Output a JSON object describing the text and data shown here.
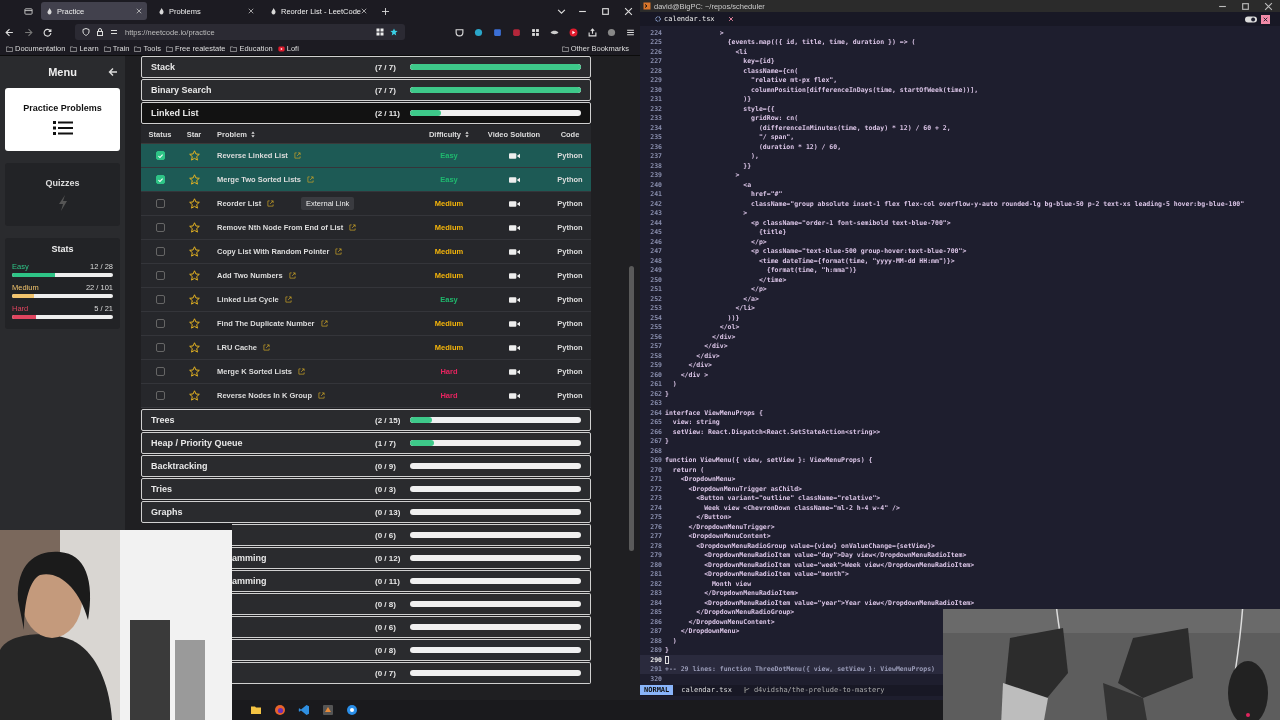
{
  "browser": {
    "tabs": [
      {
        "label": "Practice",
        "selected": true
      },
      {
        "label": "Problems",
        "selected": false
      },
      {
        "label": "Reorder List - LeetCode",
        "selected": false
      }
    ],
    "url": "https://neetcode.io/practice",
    "bookmarks": [
      {
        "label": "Documentation",
        "kind": "folder"
      },
      {
        "label": "Learn",
        "kind": "folder"
      },
      {
        "label": "Train",
        "kind": "folder"
      },
      {
        "label": "Tools",
        "kind": "folder"
      },
      {
        "label": "Free realestate",
        "kind": "folder"
      },
      {
        "label": "Education",
        "kind": "folder"
      },
      {
        "label": "Lofi",
        "kind": "video"
      }
    ],
    "other_bookmarks": "Other Bookmarks"
  },
  "sidebar": {
    "title": "Menu",
    "items": [
      {
        "label": "Practice Problems",
        "kind": "list",
        "selected": true
      },
      {
        "label": "Quizzes",
        "kind": "bolt",
        "selected": false
      }
    ],
    "stats_title": "Stats",
    "stats": [
      {
        "label": "Easy",
        "count": "12 / 28",
        "level": 0.43,
        "color": "#2ec486"
      },
      {
        "label": "Medium",
        "count": "22 / 101",
        "level": 0.22,
        "color": "#f2c46d"
      },
      {
        "label": "Hard",
        "count": "5 / 21",
        "level": 0.24,
        "color": "#e0455f"
      }
    ]
  },
  "categories": [
    {
      "name": "Stack",
      "count": "(7 / 7)",
      "level": 1,
      "expanded": false,
      "covered": false
    },
    {
      "name": "Binary Search",
      "count": "(7 / 7)",
      "level": 1,
      "expanded": false,
      "covered": false
    },
    {
      "name": "Linked List",
      "count": "(2 / 11)",
      "level": 0.18,
      "expanded": true,
      "covered": false,
      "table": {
        "columns": [
          {
            "label": "Status",
            "sortable": false
          },
          {
            "label": "Star",
            "sortable": false
          },
          {
            "label": "Problem",
            "sortable": true
          },
          {
            "label": "Difficulty",
            "sortable": true
          },
          {
            "label": "Video Solution",
            "sortable": false
          },
          {
            "label": "Code",
            "sortable": false
          }
        ],
        "tooltip": "External Link",
        "rows": [
          {
            "checked": true,
            "name": "Reverse Linked List",
            "difficulty": "Easy",
            "color": "#1fb86e",
            "code": "Python"
          },
          {
            "checked": true,
            "name": "Merge Two Sorted Lists",
            "difficulty": "Easy",
            "color": "#1fb86e",
            "code": "Python"
          },
          {
            "checked": false,
            "name": "Reorder List",
            "difficulty": "Medium",
            "color": "#f5b50a",
            "code": "Python"
          },
          {
            "checked": false,
            "name": "Remove Nth Node From End of List",
            "difficulty": "Medium",
            "color": "#f5b50a",
            "code": "Python"
          },
          {
            "checked": false,
            "name": "Copy List With Random Pointer",
            "difficulty": "Medium",
            "color": "#f5b50a",
            "code": "Python"
          },
          {
            "checked": false,
            "name": "Add Two Numbers",
            "difficulty": "Medium",
            "color": "#f5b50a",
            "code": "Python"
          },
          {
            "checked": false,
            "name": "Linked List Cycle",
            "difficulty": "Easy",
            "color": "#1fb86e",
            "code": "Python"
          },
          {
            "checked": false,
            "name": "Find The Duplicate Number",
            "difficulty": "Medium",
            "color": "#f5b50a",
            "code": "Python"
          },
          {
            "checked": false,
            "name": "LRU Cache",
            "difficulty": "Medium",
            "color": "#f5b50a",
            "code": "Python"
          },
          {
            "checked": false,
            "name": "Merge K Sorted Lists",
            "difficulty": "Hard",
            "color": "#e5245f",
            "code": "Python"
          },
          {
            "checked": false,
            "name": "Reverse Nodes In K Group",
            "difficulty": "Hard",
            "color": "#e5245f",
            "code": "Python"
          }
        ]
      }
    },
    {
      "name": "Trees",
      "count": "(2 / 15)",
      "level": 0.13,
      "expanded": false,
      "covered": false
    },
    {
      "name": "Heap / Priority Queue",
      "count": "(1 / 7)",
      "level": 0.14,
      "expanded": false,
      "covered": false
    },
    {
      "name": "Backtracking",
      "count": "(0 / 9)",
      "expanded": false,
      "covered": false
    },
    {
      "name": "Tries",
      "count": "(0 / 3)",
      "expanded": false,
      "covered": false
    },
    {
      "name": "Graphs",
      "count": "(0 / 13)",
      "expanded": false,
      "covered": false
    },
    {
      "count": "(0 / 6)",
      "expanded": false,
      "covered": true
    },
    {
      "name": "amming",
      "count": "(0 / 12)",
      "expanded": false,
      "covered": true
    },
    {
      "name": "amming",
      "count": "(0 / 11)",
      "expanded": false,
      "covered": true
    },
    {
      "count": "(0 / 8)",
      "expanded": false,
      "covered": true
    },
    {
      "count": "(0 / 6)",
      "expanded": false,
      "covered": true
    },
    {
      "count": "(0 / 8)",
      "expanded": false,
      "covered": true
    },
    {
      "count": "(0 / 7)",
      "expanded": false,
      "covered": true
    }
  ],
  "editor": {
    "title": "david@BigPC: ~/repos/scheduler",
    "tab": "calendar.tsx",
    "lines": [
      {
        "n": "224",
        "kind": "code",
        "text": "              >"
      },
      {
        "n": "225",
        "kind": "code",
        "text": "                {events.map(({ id, title, time, duration }) => ("
      },
      {
        "n": "226",
        "kind": "code",
        "text": "                  <li"
      },
      {
        "n": "227",
        "kind": "code",
        "text": "                    key={id}"
      },
      {
        "n": "228",
        "kind": "code",
        "text": "                    className={cn("
      },
      {
        "n": "229",
        "kind": "code",
        "text": "                      \"relative mt-px flex\","
      },
      {
        "n": "230",
        "kind": "code",
        "text": "                      columnPosition[differenceInDays(time, startOfWeek(time))],"
      },
      {
        "n": "231",
        "kind": "code",
        "text": "                    )}"
      },
      {
        "n": "232",
        "kind": "code",
        "text": "                    style={{"
      },
      {
        "n": "233",
        "kind": "code",
        "text": "                      gridRow: cn("
      },
      {
        "n": "234",
        "kind": "code",
        "text": "                        (differenceInMinutes(time, today) * 12) / 60 + 2,"
      },
      {
        "n": "235",
        "kind": "code",
        "text": "                        \"/ span\","
      },
      {
        "n": "236",
        "kind": "code",
        "text": "                        (duration * 12) / 60,"
      },
      {
        "n": "237",
        "kind": "code",
        "text": "                      ),"
      },
      {
        "n": "238",
        "kind": "code",
        "text": "                    }}"
      },
      {
        "n": "239",
        "kind": "code",
        "text": "                  >"
      },
      {
        "n": "240",
        "kind": "code",
        "text": "                    <a"
      },
      {
        "n": "241",
        "kind": "code",
        "text": "                      href=\"#\""
      },
      {
        "n": "242",
        "kind": "code",
        "text": "                      className=\"group absolute inset-1 flex flex-col overflow-y-auto rounded-lg bg-blue-50 p-2 text-xs leading-5 hover:bg-blue-100\""
      },
      {
        "n": "243",
        "kind": "code",
        "text": "                    >"
      },
      {
        "n": "244",
        "kind": "code",
        "text": "                      <p className=\"order-1 font-semibold text-blue-700\">"
      },
      {
        "n": "245",
        "kind": "code",
        "text": "                        {title}"
      },
      {
        "n": "246",
        "kind": "code",
        "text": "                      </p>"
      },
      {
        "n": "247",
        "kind": "code",
        "text": "                      <p className=\"text-blue-500 group-hover:text-blue-700\">"
      },
      {
        "n": "248",
        "kind": "code",
        "text": "                        <time dateTime={format(time, \"yyyy-MM-dd HH:mm\")}>"
      },
      {
        "n": "249",
        "kind": "code",
        "text": "                          {format(time, \"h:mma\")}"
      },
      {
        "n": "250",
        "kind": "code",
        "text": "                        </time>"
      },
      {
        "n": "251",
        "kind": "code",
        "text": "                      </p>"
      },
      {
        "n": "252",
        "kind": "code",
        "text": "                    </a>"
      },
      {
        "n": "253",
        "kind": "code",
        "text": "                  </li>"
      },
      {
        "n": "254",
        "kind": "code",
        "text": "                ))}"
      },
      {
        "n": "255",
        "kind": "code",
        "text": "              </ol>"
      },
      {
        "n": "256",
        "kind": "code",
        "text": "            </div>"
      },
      {
        "n": "257",
        "kind": "code",
        "text": "          </div>"
      },
      {
        "n": "258",
        "kind": "code",
        "text": "        </div>"
      },
      {
        "n": "259",
        "kind": "code",
        "text": "      </div>"
      },
      {
        "n": "260",
        "kind": "code",
        "text": "    </div >"
      },
      {
        "n": "261",
        "kind": "code",
        "text": "  )"
      },
      {
        "n": "262",
        "kind": "code",
        "text": "}"
      },
      {
        "n": "263",
        "kind": "code"
      },
      {
        "n": "264",
        "kind": "code",
        "text": "interface ViewMenuProps {"
      },
      {
        "n": "265",
        "kind": "code",
        "text": "  view: string"
      },
      {
        "n": "266",
        "kind": "code",
        "text": "  setView: React.Dispatch<React.SetStateAction<string>>"
      },
      {
        "n": "267",
        "kind": "code",
        "text": "}"
      },
      {
        "n": "268",
        "kind": "code"
      },
      {
        "n": "269",
        "kind": "code",
        "text": "function ViewMenu({ view, setView }: ViewMenuProps) {"
      },
      {
        "n": "270",
        "kind": "code",
        "text": "  return ("
      },
      {
        "n": "271",
        "kind": "code",
        "text": "    <DropdownMenu>"
      },
      {
        "n": "272",
        "kind": "code",
        "text": "      <DropdownMenuTrigger asChild>"
      },
      {
        "n": "273",
        "kind": "code",
        "text": "        <Button variant=\"outline\" className=\"relative\">"
      },
      {
        "n": "274",
        "kind": "code",
        "text": "          Week view <ChevronDown className=\"ml-2 h-4 w-4\" />"
      },
      {
        "n": "275",
        "kind": "code",
        "text": "        </Button>"
      },
      {
        "n": "276",
        "kind": "code",
        "text": "      </DropdownMenuTrigger>"
      },
      {
        "n": "277",
        "kind": "code",
        "text": "      <DropdownMenuContent>"
      },
      {
        "n": "278",
        "kind": "code",
        "text": "        <DropdownMenuRadioGroup value={view} onValueChange={setView}>"
      },
      {
        "n": "279",
        "kind": "code",
        "text": "          <DropdownMenuRadioItem value=\"day\">Day view</DropdownMenuRadioItem>"
      },
      {
        "n": "280",
        "kind": "code",
        "text": "          <DropdownMenuRadioItem value=\"week\">Week view</DropdownMenuRadioItem>"
      },
      {
        "n": "281",
        "kind": "code",
        "text": "          <DropdownMenuRadioItem value=\"month\">"
      },
      {
        "n": "282",
        "kind": "code",
        "text": "            Month view"
      },
      {
        "n": "283",
        "kind": "code",
        "text": "          </DropdownMenuRadioItem>"
      },
      {
        "n": "284",
        "kind": "code",
        "text": "          <DropdownMenuRadioItem value=\"year\">Year view</DropdownMenuRadioItem>"
      },
      {
        "n": "285",
        "kind": "code",
        "text": "        </DropdownMenuRadioGroup>"
      },
      {
        "n": "286",
        "kind": "code",
        "text": "      </DropdownMenuContent>"
      },
      {
        "n": "287",
        "kind": "code",
        "text": "    </DropdownMenu>"
      },
      {
        "n": "288",
        "kind": "code",
        "text": "  )"
      },
      {
        "n": "289",
        "kind": "code",
        "text": "}"
      },
      {
        "n": "290",
        "kind": "current"
      },
      {
        "n": "291",
        "kind": "fold",
        "text": "+-- 29 lines: function ThreeDotMenu({ view, setView }: ViewMenuProps)"
      },
      {
        "n": "320",
        "kind": "code"
      }
    ],
    "mode": "NORMAL",
    "file": "calendar.tsx",
    "branch": "d4vidsha/the-prelude-to-mastery"
  }
}
